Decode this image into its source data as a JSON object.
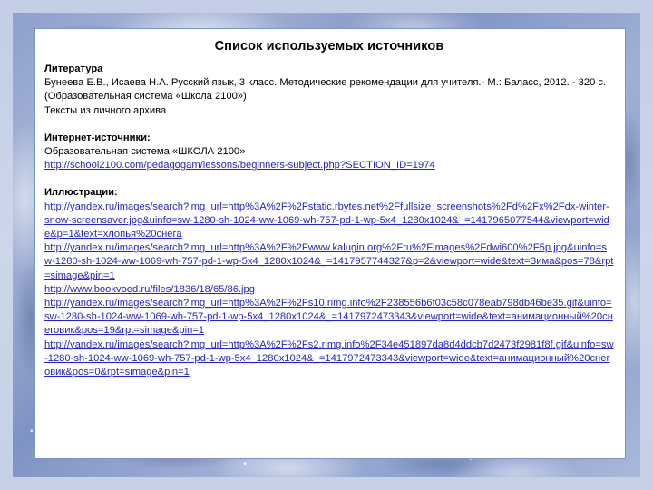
{
  "slide": {
    "title": "Список используемых источников",
    "sections": [
      {
        "id": "literature",
        "heading": "Литература",
        "lines": [
          "Бунеева Е.В., Исаева Н.А. Русский язык, 3 класс. Методические рекомендации для учителя.- М.: Баласс, 2012. - 320 с. (Образовательная система «Школа 2100»)",
          "Тексты из личного архива"
        ],
        "links": []
      },
      {
        "id": "internet-sources",
        "heading": "Интернет-источники:",
        "lines": [
          "Образовательная система «ШКОЛА 2100»"
        ],
        "links": [
          "http://school2100.com/pedagogam/lessons/beginners-subject.php?SECTION_ID=1974"
        ]
      },
      {
        "id": "illustrations",
        "heading": "Иллюстрации:",
        "lines": [],
        "links": [
          "http://yandex.ru/images/search?img_url=http%3A%2F%2Fstatic.rbytes.net%2Ffullsize_screenshots%2Fd%2Fx%2Fdx-winter-snow-screensaver.jpg&uinfo=sw-1280-sh-1024-ww-1069-wh-757-pd-1-wp-5x4_1280x1024&_=1417965077544&viewport=wide&p=1&text=хлопья%20снега",
          "http://yandex.ru/images/search?img_url=http%3A%2F%2Fwww.kalugin.org%2Fru%2Fimages%2Fdwi600%2F5p.jpg&uinfo=sw-1280-sh-1024-ww-1069-wh-757-pd-1-wp-5x4_1280x1024&_=1417957744327&p=2&viewport=wide&text=Зима&pos=78&rpt=simage&pin=1",
          "http://www.bookvoed.ru/files/1836/18/65/86.jpg",
          "http://yandex.ru/images/search?img_url=http%3A%2F%2Fs10.rimg.info%2F238556b6f03c58c078eab798db46be35.gif&uinfo=sw-1280-sh-1024-ww-1069-wh-757-pd-1-wp-5x4_1280x1024&_=1417972473343&viewport=wide&text=анимационный%20снеговик&pos=19&rpt=simage&pin=1",
          "http://yandex.ru/images/search?img_url=http%3A%2F%2Fs2.rimg.info%2F34e451897da8d4ddcb7d2473f2981f8f.gif&uinfo=sw-1280-sh-1024-ww-1069-wh-757-pd-1-wp-5x4_1280x1024&_=1417972473343&viewport=wide&text=анимационный%20снеговик&pos=0&rpt=simage&pin=1"
        ]
      }
    ]
  },
  "colors": {
    "link": "#2424c8",
    "text": "#000000",
    "panel_bg": "#ffffff",
    "panel_border": "#7a96c6",
    "slide_bg": "#c9d3e8"
  }
}
